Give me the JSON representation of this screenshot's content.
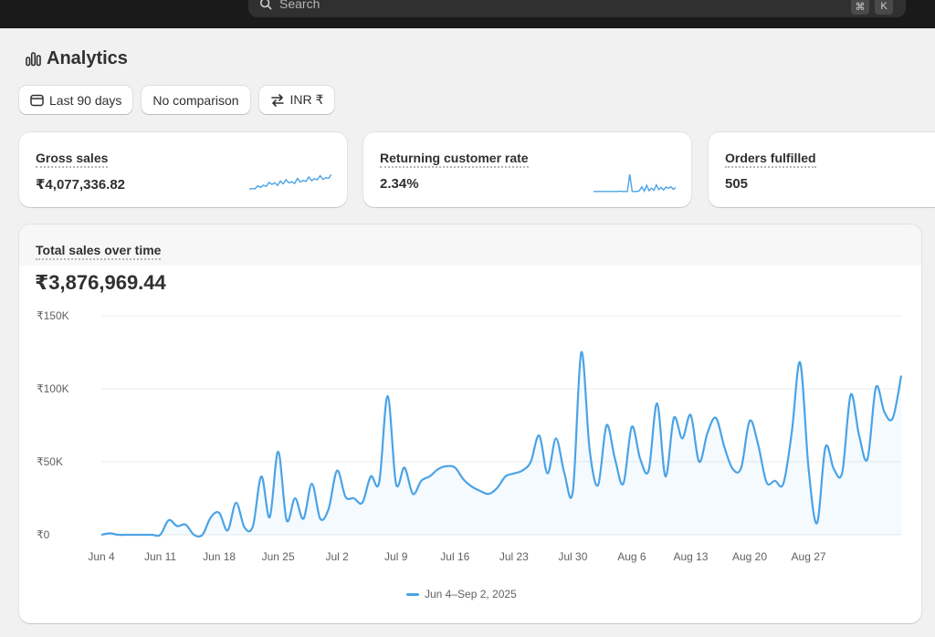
{
  "search": {
    "placeholder": "Search",
    "shortcut_keys": [
      "⌘",
      "K"
    ]
  },
  "page": {
    "title": "Analytics",
    "title_icon": "bar-chart-icon"
  },
  "filters": [
    {
      "label": "Last 90 days",
      "icon": "calendar-icon"
    },
    {
      "label": "No comparison"
    },
    {
      "label": "INR ₹",
      "icon": "currency-exchange-icon"
    }
  ],
  "metrics": {
    "gross_sales": {
      "label": "Gross sales",
      "value": "₹4,077,336.82"
    },
    "returning_rate": {
      "label": "Returning customer rate",
      "value": "2.34%"
    },
    "orders_fulfilled": {
      "label": "Orders fulfilled",
      "value": "505"
    }
  },
  "sparklines": {
    "gross_sales": [
      1,
      1.2,
      1.1,
      2,
      1.5,
      2.2,
      1.8,
      3,
      2.4,
      2.9,
      2.1,
      3.4,
      2.6,
      3.8,
      2.9,
      3.2,
      2.7,
      4.2,
      3.1,
      3.6,
      3.3,
      4.6,
      3.5,
      4.1,
      3.8,
      5,
      3.9,
      4.4,
      4.2,
      5.4
    ],
    "returning_rate": [
      0.3,
      0.3,
      0.3,
      0.3,
      0.3,
      0.3,
      0.3,
      0.3,
      0.3,
      0.3,
      0.3,
      0.4,
      0.3,
      0.3,
      0.3,
      5,
      0.3,
      0.3,
      0.3,
      0.5,
      1.6,
      0.4,
      2,
      0.5,
      1.2,
      0.6,
      2.1,
      0.8,
      1.4,
      0.7,
      1.5,
      1.2,
      1.6,
      0.9,
      1.4
    ]
  },
  "colors": {
    "accent": "#4ba3e6"
  },
  "chart_data": {
    "type": "line",
    "title": "Total sales over time",
    "total": "₹3,876,969.44",
    "y_tick_labels": [
      "₹150K",
      "₹100K",
      "₹50K",
      "₹0"
    ],
    "y_ticks": [
      150000,
      100000,
      50000,
      0
    ],
    "ylim": [
      0,
      150000
    ],
    "x_tick_labels": [
      "Jun 4",
      "Jun 11",
      "Jun 18",
      "Jun 25",
      "Jul 2",
      "Jul 9",
      "Jul 16",
      "Jul 23",
      "Jul 30",
      "Aug 6",
      "Aug 13",
      "Aug 20",
      "Aug 27"
    ],
    "x_days": 90,
    "grid": true,
    "series": [
      {
        "name": "Jun 4–Sep 2, 2025",
        "values": [
          0,
          1000,
          0,
          0,
          0,
          0,
          0,
          0,
          10000,
          6000,
          7000,
          0,
          0,
          12000,
          15000,
          3000,
          22000,
          5000,
          6000,
          40000,
          12000,
          57000,
          10000,
          25000,
          11000,
          35000,
          11000,
          18000,
          44000,
          26000,
          25000,
          22000,
          40000,
          36000,
          95000,
          35000,
          46000,
          28000,
          37000,
          40000,
          45000,
          47000,
          46000,
          38000,
          33000,
          30000,
          28000,
          32000,
          40000,
          42000,
          44000,
          50000,
          68000,
          42000,
          66000,
          42000,
          30000,
          125000,
          58000,
          34000,
          75000,
          52000,
          35000,
          74000,
          52000,
          44000,
          90000,
          40000,
          80000,
          66000,
          82000,
          50000,
          70000,
          80000,
          60000,
          45000,
          46000,
          78000,
          62000,
          36000,
          37000,
          35000,
          70000,
          118000,
          45000,
          8000,
          60000,
          45000,
          43000,
          96000,
          68000,
          52000,
          101000,
          84000,
          80000,
          109000
        ]
      }
    ],
    "legend_position": "bottom-center"
  }
}
